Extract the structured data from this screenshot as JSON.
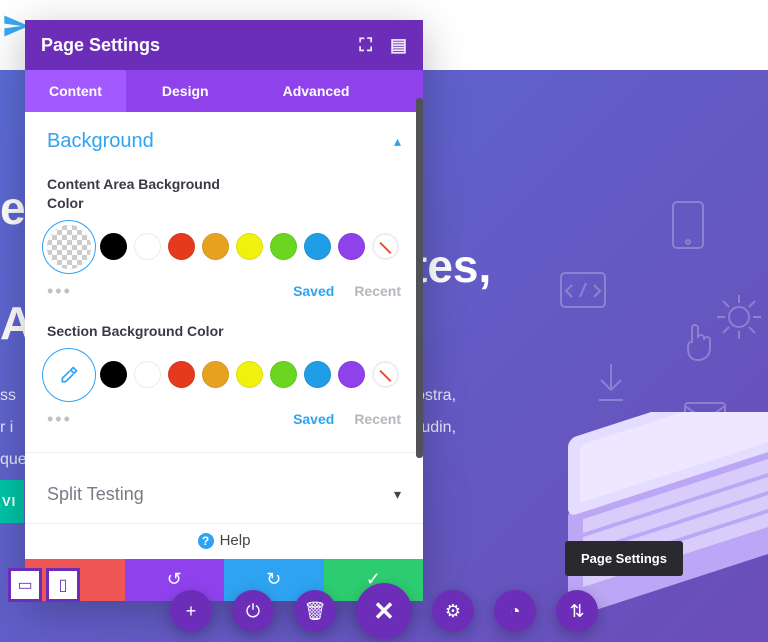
{
  "page": {
    "hero_line1": "e",
    "hero_line2": "tes,",
    "hero_line3": "Ap",
    "para_line1": "ss",
    "para_line2": "ostra,",
    "para_line3": "r i",
    "para_line4": "itudin,",
    "para_line5": "que",
    "cta": "VI"
  },
  "panel": {
    "title": "Page Settings",
    "tabs": {
      "content": "Content",
      "design": "Design",
      "advanced": "Advanced"
    },
    "sections": {
      "background": "Background",
      "split_testing": "Split Testing"
    },
    "fields": {
      "content_bg_label": "Content Area Background Color",
      "section_bg_label": "Section Background Color"
    },
    "palette": {
      "colors": [
        "#000000",
        "#ffffff",
        "#e63a1f",
        "#e6a21f",
        "#f1f10f",
        "#6bd61f",
        "#1f9de6",
        "#8f42ec"
      ],
      "saved": "Saved",
      "recent": "Recent"
    },
    "help": "Help"
  },
  "tooltip": "Page Settings",
  "icons": {
    "expand": "⛶",
    "columns": "▤",
    "chevron_up": "▴",
    "chevron_down": "▾",
    "dots": "•••",
    "cancel": "✕",
    "undo": "↺",
    "redo": "↻",
    "check": "✓",
    "plus": "+",
    "power": "⏻",
    "trash": "🗑",
    "close": "✕",
    "gear": "⚙",
    "clock": "◔",
    "sliders": "⇅",
    "desktop": "▭",
    "mobile": "▯"
  }
}
